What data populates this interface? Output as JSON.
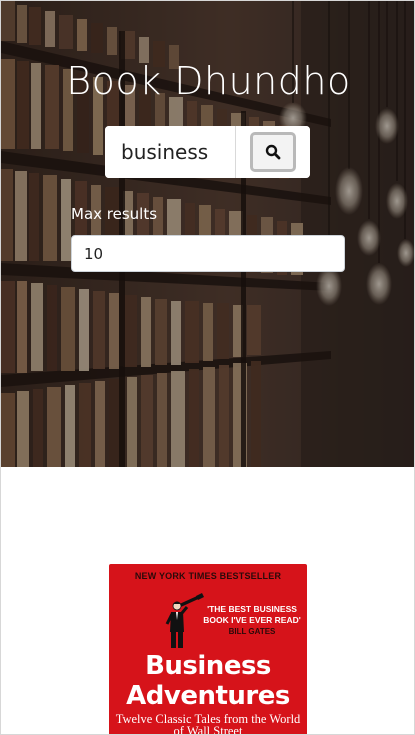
{
  "app": {
    "title": "Book Dhundho"
  },
  "search": {
    "value": "business",
    "button_icon": "search-icon"
  },
  "max_results": {
    "label": "Max results",
    "value": "10"
  },
  "results": [
    {
      "cover": {
        "bestseller_banner": "NEW YORK TIMES BESTSELLER",
        "quote_text": "'THE BEST BUSINESS BOOK I'VE EVER READ'",
        "quote_author": "BILL GATES",
        "title": "Business Adventures",
        "subtitle": "Twelve Classic Tales from the World of Wall Street",
        "color": "#d6131a"
      }
    }
  ],
  "colors": {
    "hero_overlay": "#120c0a",
    "text_light": "#ffffff"
  }
}
